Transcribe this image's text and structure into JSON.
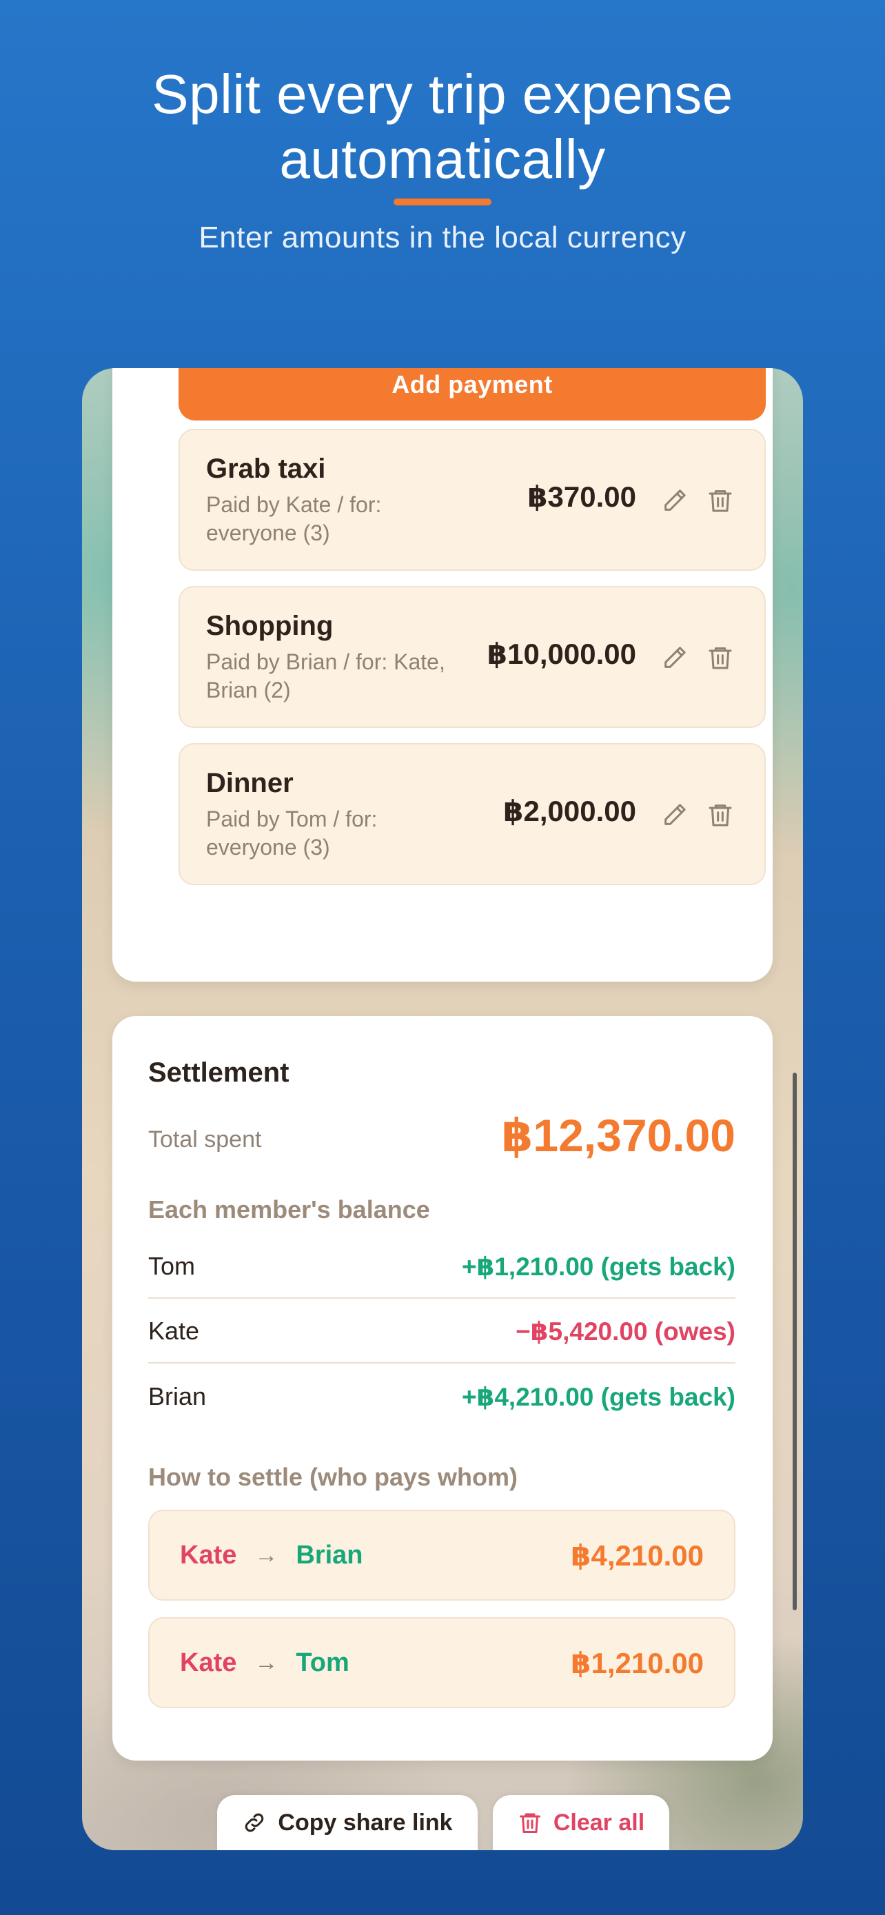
{
  "hero": {
    "title_line1": "Split every trip expense",
    "title_line2": "automatically",
    "subtitle": "Enter amounts in the local currency"
  },
  "colors": {
    "accent": "#f47a2f",
    "positive": "#17a77a",
    "negative": "#e14463",
    "item_bg": "#fdf1e1"
  },
  "add_payment_label": "Add payment",
  "payments": [
    {
      "name": "Grab taxi",
      "meta": "Paid by Kate / for: everyone (3)",
      "amount": "฿370.00"
    },
    {
      "name": "Shopping",
      "meta": "Paid by Brian / for: Kate, Brian (2)",
      "amount": "฿10,000.00"
    },
    {
      "name": "Dinner",
      "meta": "Paid by Tom / for: everyone (3)",
      "amount": "฿2,000.00"
    }
  ],
  "icons": {
    "edit": "pencil-icon",
    "delete": "trash-icon",
    "link": "link-icon"
  },
  "settlement": {
    "title": "Settlement",
    "total_label": "Total spent",
    "total_value": "฿12,370.00",
    "balance_heading": "Each member's balance",
    "balances": [
      {
        "name": "Tom",
        "value": "+฿1,210.00 (gets back)"
      },
      {
        "name": "Kate",
        "value": "−฿5,420.00 (owes)"
      },
      {
        "name": "Brian",
        "value": "+฿4,210.00 (gets back)"
      }
    ],
    "how_heading": "How to settle (who pays whom)",
    "transfers": [
      {
        "from": "Kate",
        "arrow": "→",
        "to": "Brian",
        "amount": "฿4,210.00"
      },
      {
        "from": "Kate",
        "arrow": "→",
        "to": "Tom",
        "amount": "฿1,210.00"
      }
    ]
  },
  "bottom": {
    "copy_label": "Copy share link",
    "clear_label": "Clear all"
  }
}
